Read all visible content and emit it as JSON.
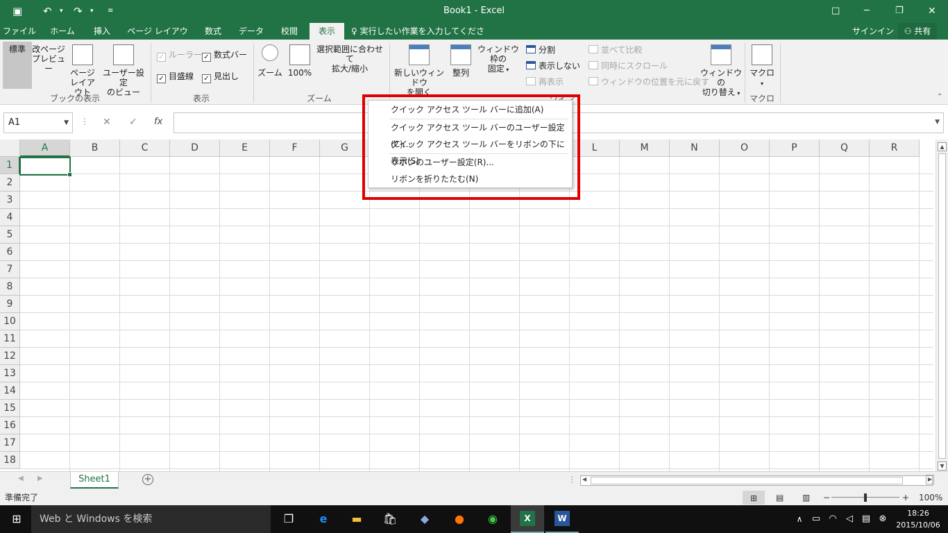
{
  "window": {
    "title": "Book1 - Excel"
  },
  "qat": {
    "save_icon": "save-icon",
    "undo_icon": "undo-icon",
    "redo_icon": "redo-icon",
    "customize_icon": "customize-icon"
  },
  "window_buttons": {
    "ribbon_display": "□",
    "minimize": "─",
    "restore": "❐",
    "close": "✕"
  },
  "tabs": [
    "ファイル",
    "ホーム",
    "挿入",
    "ページ レイアウト",
    "数式",
    "データ",
    "校閲",
    "表示"
  ],
  "tell_me": "実行したい作業を入力してください...",
  "signin": "サインイン",
  "share": "共有",
  "ribbon": {
    "book_views": {
      "group": "ブックの表示",
      "normal": "標準",
      "page_break_1": "改ページ",
      "page_break_2": "プレビュー",
      "page_layout_1": "ページ",
      "page_layout_2": "レイアウト",
      "custom_1": "ユーザー設定",
      "custom_2": "のビュー"
    },
    "show": {
      "group": "表示",
      "ruler": "ルーラー",
      "formula_bar": "数式バー",
      "gridlines": "目盛線",
      "headings": "見出し"
    },
    "zoom": {
      "group": "ズーム",
      "zoom": "ズーム",
      "hundred": "100%",
      "to_sel_1": "選択範囲に合わせて",
      "to_sel_2": "拡大/縮小"
    },
    "window": {
      "group": "ウィンドウ",
      "new_win_1": "新しいウィンドウ",
      "new_win_2": "を開く",
      "arrange": "整列",
      "freeze_1": "ウィンドウ枠の",
      "freeze_2": "固定",
      "split": "分割",
      "hide": "表示しない",
      "unhide": "再表示",
      "side_by_side": "並べて比較",
      "sync_scroll": "同時にスクロール",
      "reset_pos": "ウィンドウの位置を元に戻す",
      "switch_1": "ウィンドウの",
      "switch_2": "切り替え"
    },
    "macros": {
      "group": "マクロ",
      "macro": "マクロ"
    }
  },
  "name_box": "A1",
  "fx": "fx",
  "columns": [
    "A",
    "B",
    "C",
    "D",
    "E",
    "F",
    "G",
    "H",
    "I",
    "J",
    "K",
    "L",
    "M",
    "N",
    "O",
    "P",
    "Q",
    "R"
  ],
  "rows": [
    "1",
    "2",
    "3",
    "4",
    "5",
    "6",
    "7",
    "8",
    "9",
    "10",
    "11",
    "12",
    "13",
    "14",
    "15",
    "16",
    "17",
    "18"
  ],
  "context_menu": [
    "クイック アクセス ツール バーに追加(A)",
    "クイック アクセス ツール バーのユーザー設定(C)...",
    "クイック アクセス ツール バーをリボンの下に表示(S)",
    "リボンのユーザー設定(R)...",
    "リボンを折りたたむ(N)"
  ],
  "sheet": {
    "name": "Sheet1",
    "add": "+"
  },
  "status": {
    "ready": "準備完了",
    "zoom": "100%",
    "minus": "−",
    "plus": "+"
  },
  "taskbar": {
    "search": "Web と Windows を検索",
    "time": "18:26",
    "date": "2015/10/06"
  },
  "colors": {
    "excel_green": "#217346",
    "highlight_red": "#e00000"
  }
}
